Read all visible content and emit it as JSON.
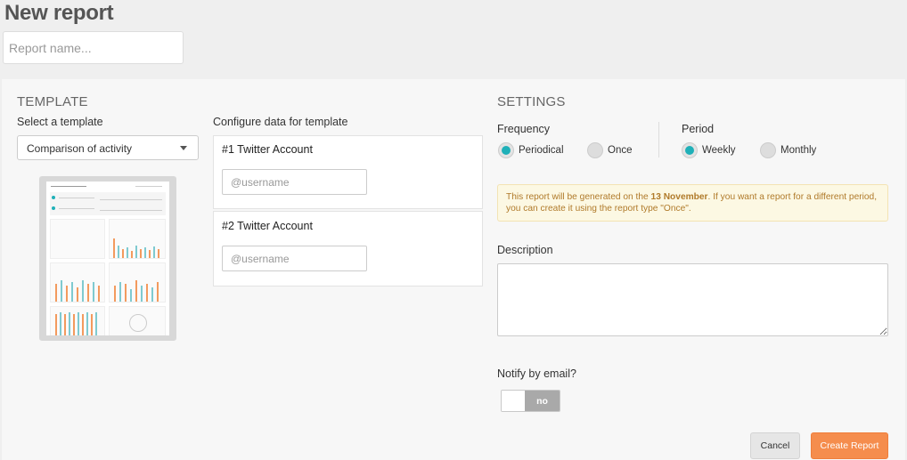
{
  "page": {
    "title": "New report"
  },
  "report_name": {
    "placeholder": "Report name...",
    "value": ""
  },
  "template": {
    "heading": "TEMPLATE",
    "select_label": "Select a template",
    "selected": "Comparison of activity",
    "configure_label": "Configure data for template",
    "accounts": [
      {
        "title": "#1 Twitter Account",
        "placeholder": "@username",
        "value": ""
      },
      {
        "title": "#2 Twitter Account",
        "placeholder": "@username",
        "value": ""
      }
    ]
  },
  "settings": {
    "heading": "SETTINGS",
    "frequency": {
      "label": "Frequency",
      "options": [
        {
          "label": "Periodical",
          "selected": true
        },
        {
          "label": "Once",
          "selected": false
        }
      ]
    },
    "period": {
      "label": "Period",
      "options": [
        {
          "label": "Weekly",
          "selected": true
        },
        {
          "label": "Monthly",
          "selected": false
        }
      ]
    },
    "notice": {
      "before": "This report will be generated on the ",
      "date": "13 November",
      "after": ". If you want a report for a different period, you can create it using the report type \"Once\"."
    },
    "description": {
      "label": "Description",
      "value": ""
    },
    "notify": {
      "label": "Notify by email?",
      "state": "no"
    }
  },
  "actions": {
    "cancel": "Cancel",
    "create": "Create Report"
  },
  "colors": {
    "accent": "#1fb0b8",
    "primary_button": "#f58d4d",
    "notice_bg": "#fcf8e3",
    "notice_text": "#b07a2a"
  }
}
